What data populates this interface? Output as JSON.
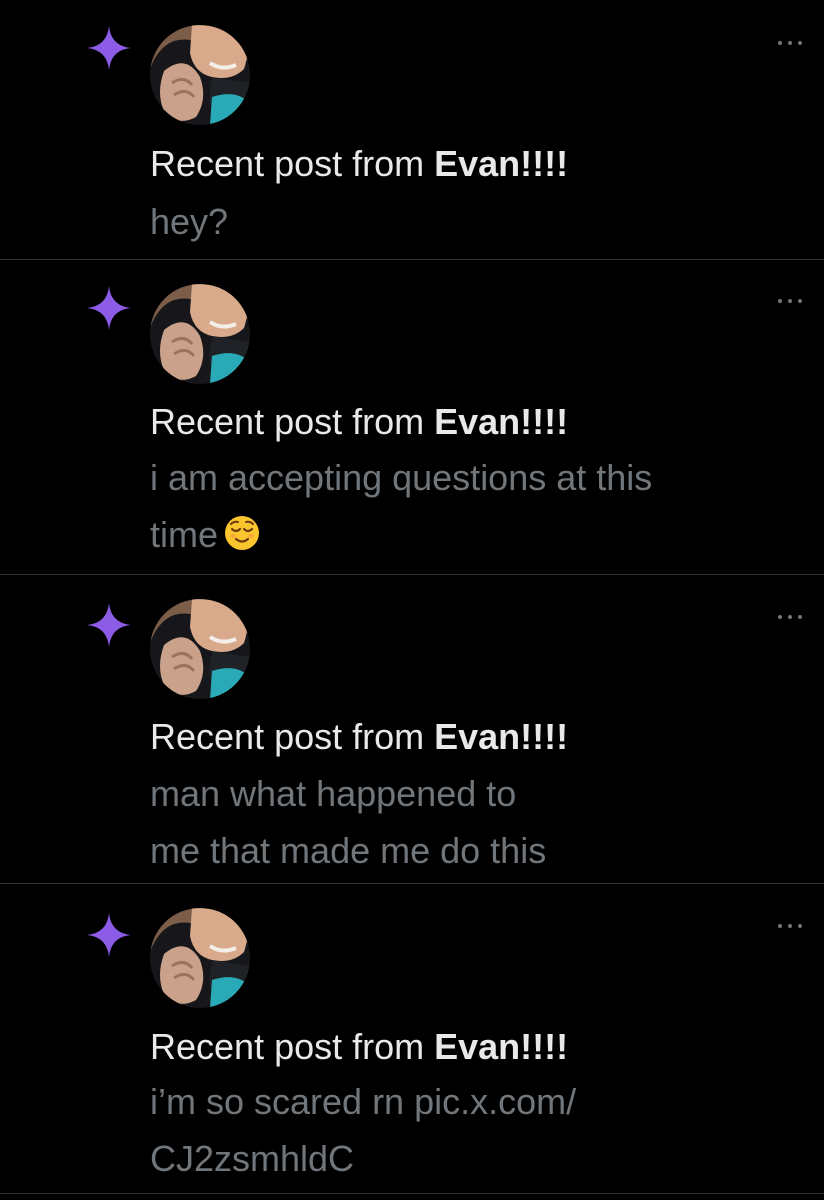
{
  "notifications": [
    {
      "prefix": "Recent post from ",
      "author": "Evan!!!!",
      "text_lines": [
        "hey?"
      ],
      "icon": "sparkle-icon",
      "menu": "more-options-icon"
    },
    {
      "prefix": "Recent post from ",
      "author": "Evan!!!!",
      "text_lines": [
        "i am accepting questions at this",
        "time"
      ],
      "emoji": "relieved-face-emoji",
      "icon": "sparkle-icon",
      "menu": "more-options-icon"
    },
    {
      "prefix": "Recent post from ",
      "author": "Evan!!!!",
      "text_lines": [
        "man what happened to",
        "me that made me do this"
      ],
      "icon": "sparkle-icon",
      "menu": "more-options-icon"
    },
    {
      "prefix": "Recent post from ",
      "author": "Evan!!!!",
      "text_lines": [
        "i’m so scared rn pic.x.com/",
        "CJ2zsmhldC"
      ],
      "icon": "sparkle-icon",
      "menu": "more-options-icon"
    }
  ],
  "colors": {
    "background": "#000000",
    "sparkle": "#8c5ce6",
    "primary_text": "#e7e9ea",
    "secondary_text": "#71767b",
    "divider": "#2f3336"
  }
}
